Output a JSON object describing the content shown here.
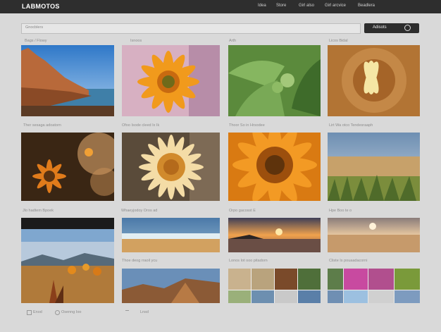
{
  "app": {
    "brand": "LABMOTOS"
  },
  "nav": [
    "Idea",
    "Store",
    "Girl also",
    "Girl arcvice",
    "Beadlera"
  ],
  "search": {
    "placeholder": "Gnocblers"
  },
  "action_button": {
    "label": "Adisots"
  },
  "row_labels": [
    [
      "Bags / Flowy",
      "Isnoos",
      "Arth",
      "Licos Bidal"
    ],
    [
      "Ther sesaga adoatorn",
      "Ofoo Isode cleed Ix Ik",
      "Thoor So in Hrsodee",
      "Lirt Wa otco Tendesraaph"
    ],
    [
      "Jlo hadtem Bpoek",
      "Whaeyjodoy Oros ad",
      "Orpo gacosst E",
      "Hpe Boo te o"
    ],
    [
      "",
      "Thoe deog rraoil ycu",
      "Lonos Iot ooo pitadorn",
      "Cliste Is pouaadacorni"
    ]
  ],
  "footer": [
    "Enod",
    "Osenng Ioo",
    "",
    "Lnsd"
  ]
}
